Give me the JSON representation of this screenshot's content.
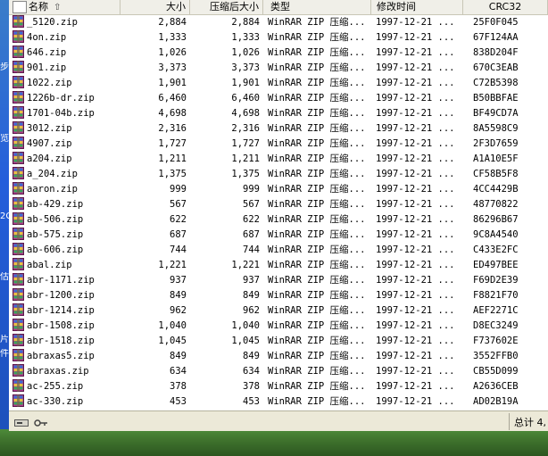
{
  "desktop": {
    "labels": [
      "步",
      "览",
      "2C",
      "估",
      "片",
      "件"
    ]
  },
  "columns": {
    "name": "名称",
    "size": "大小",
    "packed": "压缩后大小",
    "type": "类型",
    "modified": "修改时间",
    "crc": "CRC32"
  },
  "files": [
    {
      "name": "_5120.zip",
      "size": "2,884",
      "packed": "2,884",
      "type": "WinRAR ZIP 压缩...",
      "modified": "1997-12-21 ...",
      "crc": "25F0F045"
    },
    {
      "name": "4on.zip",
      "size": "1,333",
      "packed": "1,333",
      "type": "WinRAR ZIP 压缩...",
      "modified": "1997-12-21 ...",
      "crc": "67F124AA"
    },
    {
      "name": "646.zip",
      "size": "1,026",
      "packed": "1,026",
      "type": "WinRAR ZIP 压缩...",
      "modified": "1997-12-21 ...",
      "crc": "838D204F"
    },
    {
      "name": "901.zip",
      "size": "3,373",
      "packed": "3,373",
      "type": "WinRAR ZIP 压缩...",
      "modified": "1997-12-21 ...",
      "crc": "670C3EAB"
    },
    {
      "name": "1022.zip",
      "size": "1,901",
      "packed": "1,901",
      "type": "WinRAR ZIP 压缩...",
      "modified": "1997-12-21 ...",
      "crc": "C72B5398"
    },
    {
      "name": "1226b-dr.zip",
      "size": "6,460",
      "packed": "6,460",
      "type": "WinRAR ZIP 压缩...",
      "modified": "1997-12-21 ...",
      "crc": "B50BBFAE"
    },
    {
      "name": "1701-04b.zip",
      "size": "4,698",
      "packed": "4,698",
      "type": "WinRAR ZIP 压缩...",
      "modified": "1997-12-21 ...",
      "crc": "BF49CD7A"
    },
    {
      "name": "3012.zip",
      "size": "2,316",
      "packed": "2,316",
      "type": "WinRAR ZIP 压缩...",
      "modified": "1997-12-21 ...",
      "crc": "8A5598C9"
    },
    {
      "name": "4907.zip",
      "size": "1,727",
      "packed": "1,727",
      "type": "WinRAR ZIP 压缩...",
      "modified": "1997-12-21 ...",
      "crc": "2F3D7659"
    },
    {
      "name": "a204.zip",
      "size": "1,211",
      "packed": "1,211",
      "type": "WinRAR ZIP 压缩...",
      "modified": "1997-12-21 ...",
      "crc": "A1A10E5F"
    },
    {
      "name": "a_204.zip",
      "size": "1,375",
      "packed": "1,375",
      "type": "WinRAR ZIP 压缩...",
      "modified": "1997-12-21 ...",
      "crc": "CF58B5F8"
    },
    {
      "name": "aaron.zip",
      "size": "999",
      "packed": "999",
      "type": "WinRAR ZIP 压缩...",
      "modified": "1997-12-21 ...",
      "crc": "4CC4429B"
    },
    {
      "name": "ab-429.zip",
      "size": "567",
      "packed": "567",
      "type": "WinRAR ZIP 压缩...",
      "modified": "1997-12-21 ...",
      "crc": "48770822"
    },
    {
      "name": "ab-506.zip",
      "size": "622",
      "packed": "622",
      "type": "WinRAR ZIP 压缩...",
      "modified": "1997-12-21 ...",
      "crc": "86296B67"
    },
    {
      "name": "ab-575.zip",
      "size": "687",
      "packed": "687",
      "type": "WinRAR ZIP 压缩...",
      "modified": "1997-12-21 ...",
      "crc": "9C8A4540"
    },
    {
      "name": "ab-606.zip",
      "size": "744",
      "packed": "744",
      "type": "WinRAR ZIP 压缩...",
      "modified": "1997-12-21 ...",
      "crc": "C433E2FC"
    },
    {
      "name": "abal.zip",
      "size": "1,221",
      "packed": "1,221",
      "type": "WinRAR ZIP 压缩...",
      "modified": "1997-12-21 ...",
      "crc": "ED497BEE"
    },
    {
      "name": "abr-1171.zip",
      "size": "937",
      "packed": "937",
      "type": "WinRAR ZIP 压缩...",
      "modified": "1997-12-21 ...",
      "crc": "F69D2E39"
    },
    {
      "name": "abr-1200.zip",
      "size": "849",
      "packed": "849",
      "type": "WinRAR ZIP 压缩...",
      "modified": "1997-12-21 ...",
      "crc": "F8821F70"
    },
    {
      "name": "abr-1214.zip",
      "size": "962",
      "packed": "962",
      "type": "WinRAR ZIP 压缩...",
      "modified": "1997-12-21 ...",
      "crc": "AEF2271C"
    },
    {
      "name": "abr-1508.zip",
      "size": "1,040",
      "packed": "1,040",
      "type": "WinRAR ZIP 压缩...",
      "modified": "1997-12-21 ...",
      "crc": "D8EC3249"
    },
    {
      "name": "abr-1518.zip",
      "size": "1,045",
      "packed": "1,045",
      "type": "WinRAR ZIP 压缩...",
      "modified": "1997-12-21 ...",
      "crc": "F737602E"
    },
    {
      "name": "abraxas5.zip",
      "size": "849",
      "packed": "849",
      "type": "WinRAR ZIP 压缩...",
      "modified": "1997-12-21 ...",
      "crc": "3552FFB0"
    },
    {
      "name": "abraxas.zip",
      "size": "634",
      "packed": "634",
      "type": "WinRAR ZIP 压缩...",
      "modified": "1997-12-21 ...",
      "crc": "CB55D099"
    },
    {
      "name": "ac-255.zip",
      "size": "378",
      "packed": "378",
      "type": "WinRAR ZIP 压缩...",
      "modified": "1997-12-21 ...",
      "crc": "A2636CEB"
    },
    {
      "name": "ac-330.zip",
      "size": "453",
      "packed": "453",
      "type": "WinRAR ZIP 压缩...",
      "modified": "1997-12-21 ...",
      "crc": "AD02B19A"
    }
  ],
  "status": {
    "total": "总计 4,"
  },
  "icons": {
    "file": "winrar-zip-icon",
    "sort": "sort-up-icon",
    "status_left": "drive-icon",
    "status_key": "key-icon"
  }
}
